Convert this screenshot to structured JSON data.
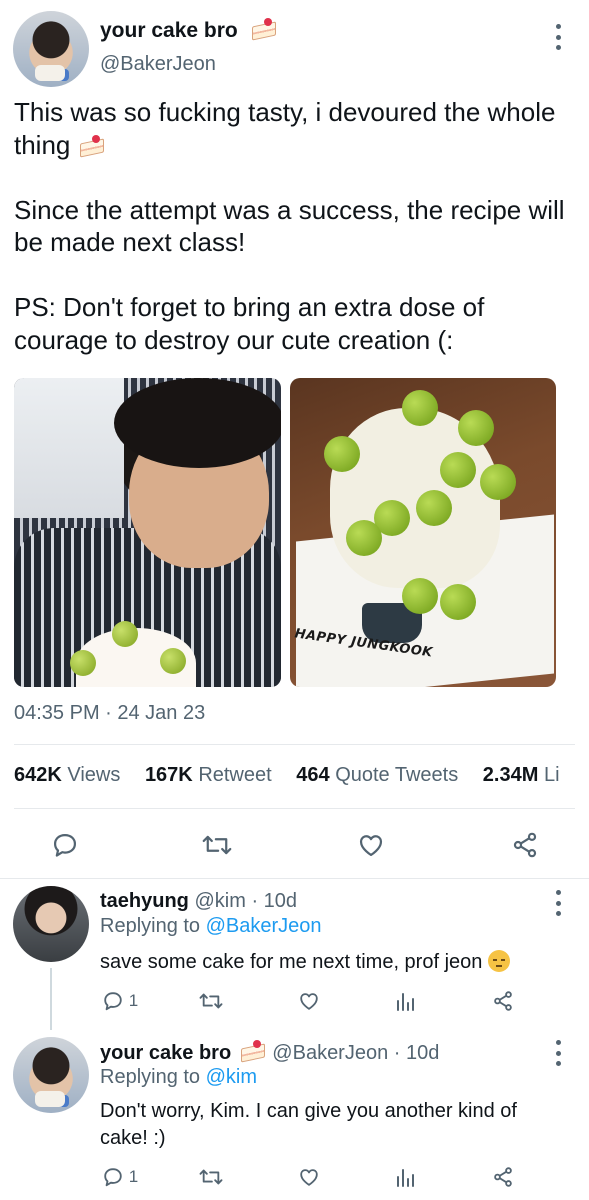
{
  "tweet": {
    "author_name": "your cake bro",
    "author_handle": "@BakerJeon",
    "text_paragraphs": [
      "This was so fucking tasty, i devoured the whole thing",
      "Since the attempt was a success, the recipe will be made next class!",
      "PS: Don't forget to bring an extra dose of courage to destroy our cute creation (:"
    ],
    "image_caption_text": "HAPPY JUNGKOOK",
    "timestamp": "04:35 PM · 24 Jan 23",
    "stats": {
      "views_count": "642K",
      "views_label": "Views",
      "retweets_count": "167K",
      "retweets_label": "Retweet",
      "quotes_count": "464",
      "quotes_label": "Quote Tweets",
      "likes_count": "2.34M",
      "likes_label": "Li"
    }
  },
  "replies": [
    {
      "name": "taehyung",
      "handle": "@kim",
      "age": "· 10d",
      "replying_prefix": "Replying to",
      "replying_to": "@BakerJeon",
      "text": "save some cake for me next time, prof jeon",
      "reply_count": "1"
    },
    {
      "name": "your cake bro",
      "handle": "@BakerJeon",
      "age": "· 10d",
      "replying_prefix": "Replying to",
      "replying_to": "@kim",
      "text": "Don't worry, Kim. I can give you another kind of cake! :)",
      "reply_count": "1"
    }
  ],
  "icons": {
    "reply": "reply-icon",
    "retweet": "retweet-icon",
    "like": "heart-icon",
    "share": "share-icon",
    "analytics": "analytics-icon",
    "more": "more-dots-icon"
  },
  "colors": {
    "text": "#0f1419",
    "muted": "#536471",
    "link": "#1d9bf0",
    "divider": "#e6e9ec"
  }
}
